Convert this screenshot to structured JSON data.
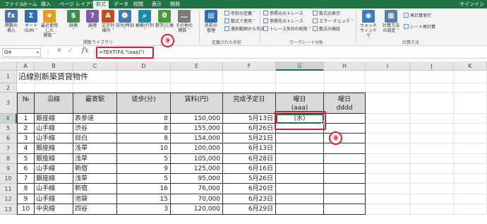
{
  "tabs": [
    "ファイル",
    "ホーム",
    "挿入",
    "ページ レイアウト",
    "数式",
    "データ",
    "校閲",
    "表示",
    "開発"
  ],
  "active_tab": "数式",
  "signin": "サインイン",
  "ribbon": {
    "big_buttons": [
      {
        "label": "関数の\n挿入",
        "icon": "fx-icon"
      },
      {
        "label": "オート\nSUM ˅",
        "icon": "sigma-icon"
      },
      {
        "label": "最近使用した\n関数 ˅",
        "icon": "star-icon"
      },
      {
        "label": "財務\n˅",
        "icon": "finance-icon"
      },
      {
        "label": "論理\n˅",
        "icon": "logic-icon"
      },
      {
        "label": "文字列\n操作 ˅",
        "icon": "text-icon"
      },
      {
        "label": "日付/時刻\n˅",
        "icon": "date-icon"
      },
      {
        "label": "検索/行列\n˅",
        "icon": "lookup-icon"
      },
      {
        "label": "数学/三角\n˅",
        "icon": "math-icon"
      },
      {
        "label": "その他の\n関数 ˅",
        "icon": "more-functions-icon"
      },
      {
        "label": "名前の\n管理",
        "icon": "name-manager-icon"
      },
      {
        "label": "ウォッチ\nウィンドウ",
        "icon": "watch-window-icon"
      },
      {
        "label": "計算方法\nの設定 ˅",
        "icon": "calc-options-icon"
      }
    ],
    "small_buttons": [
      {
        "label": "名前の定義 ˅"
      },
      {
        "label": "数式で使用 ˅"
      },
      {
        "label": "選択範囲から作成"
      },
      {
        "label": "参照元のトレース"
      },
      {
        "label": "参照先のトレース"
      },
      {
        "label": "トレース矢印の削除 ˅"
      },
      {
        "label": "数式の表示"
      },
      {
        "label": "エラー チェック ˅"
      },
      {
        "label": "数式の検証"
      },
      {
        "label": "再計算実行"
      },
      {
        "label": "シート再計算"
      }
    ],
    "groups": [
      "関数ライブラリ",
      "定義された名前",
      "ワークシート分析",
      "計算方法"
    ]
  },
  "formula_bar": {
    "name_box": "G4",
    "formula": "=TEXT(F4,\"(aaa)\")"
  },
  "annotations": {
    "formula_marker": "⑨",
    "cell_marker": "⑧",
    "color": "#e8192c"
  },
  "columns": [
    "A",
    "B",
    "C",
    "D",
    "E",
    "F",
    "G",
    "H",
    "I",
    "J",
    "K"
  ],
  "rows": [
    "1",
    "2",
    "3",
    "4",
    "5",
    "6",
    "7",
    "8",
    "9",
    "10",
    "11",
    "12",
    "13"
  ],
  "sheet": {
    "title": "沿線別新築賃貸物件",
    "headers": [
      "№",
      "沿線",
      "最寄駅",
      "徒歩(分)",
      "賃料(円)",
      "完成予定日",
      "曜日\n(aaa)",
      "曜日\ndddd"
    ],
    "records": [
      {
        "no": "1",
        "line": "銀座線",
        "station": "表参道",
        "walk": "8",
        "rent": "150,000",
        "date": "5月13日",
        "day": "(水)"
      },
      {
        "no": "2",
        "line": "山手線",
        "station": "渋谷",
        "walk": "8",
        "rent": "155,000",
        "date": "6月26日",
        "day": ""
      },
      {
        "no": "3",
        "line": "山手線",
        "station": "目白",
        "walk": "8",
        "rent": "154,000",
        "date": "5月21日",
        "day": ""
      },
      {
        "no": "4",
        "line": "銀座線",
        "station": "浅草",
        "walk": "10",
        "rent": "100,000",
        "date": "6月13日",
        "day": ""
      },
      {
        "no": "5",
        "line": "銀座線",
        "station": "浅草",
        "walk": "5",
        "rent": "105,000",
        "date": "6月28日",
        "day": ""
      },
      {
        "no": "6",
        "line": "山手線",
        "station": "新宿",
        "walk": "9",
        "rent": "125,000",
        "date": "6月16日",
        "day": ""
      },
      {
        "no": "7",
        "line": "銀座線",
        "station": "浅草",
        "walk": "5",
        "rent": "95,000",
        "date": "5月26日",
        "day": ""
      },
      {
        "no": "8",
        "line": "山手線",
        "station": "新宿",
        "walk": "16",
        "rent": "76,000",
        "date": "6月20日",
        "day": ""
      },
      {
        "no": "9",
        "line": "山手線",
        "station": "池袋",
        "walk": "15",
        "rent": "70,000",
        "date": "6月23日",
        "day": ""
      },
      {
        "no": "10",
        "line": "中央線",
        "station": "四谷",
        "walk": "3",
        "rent": "120,000",
        "date": "6月29日",
        "day": ""
      }
    ]
  }
}
